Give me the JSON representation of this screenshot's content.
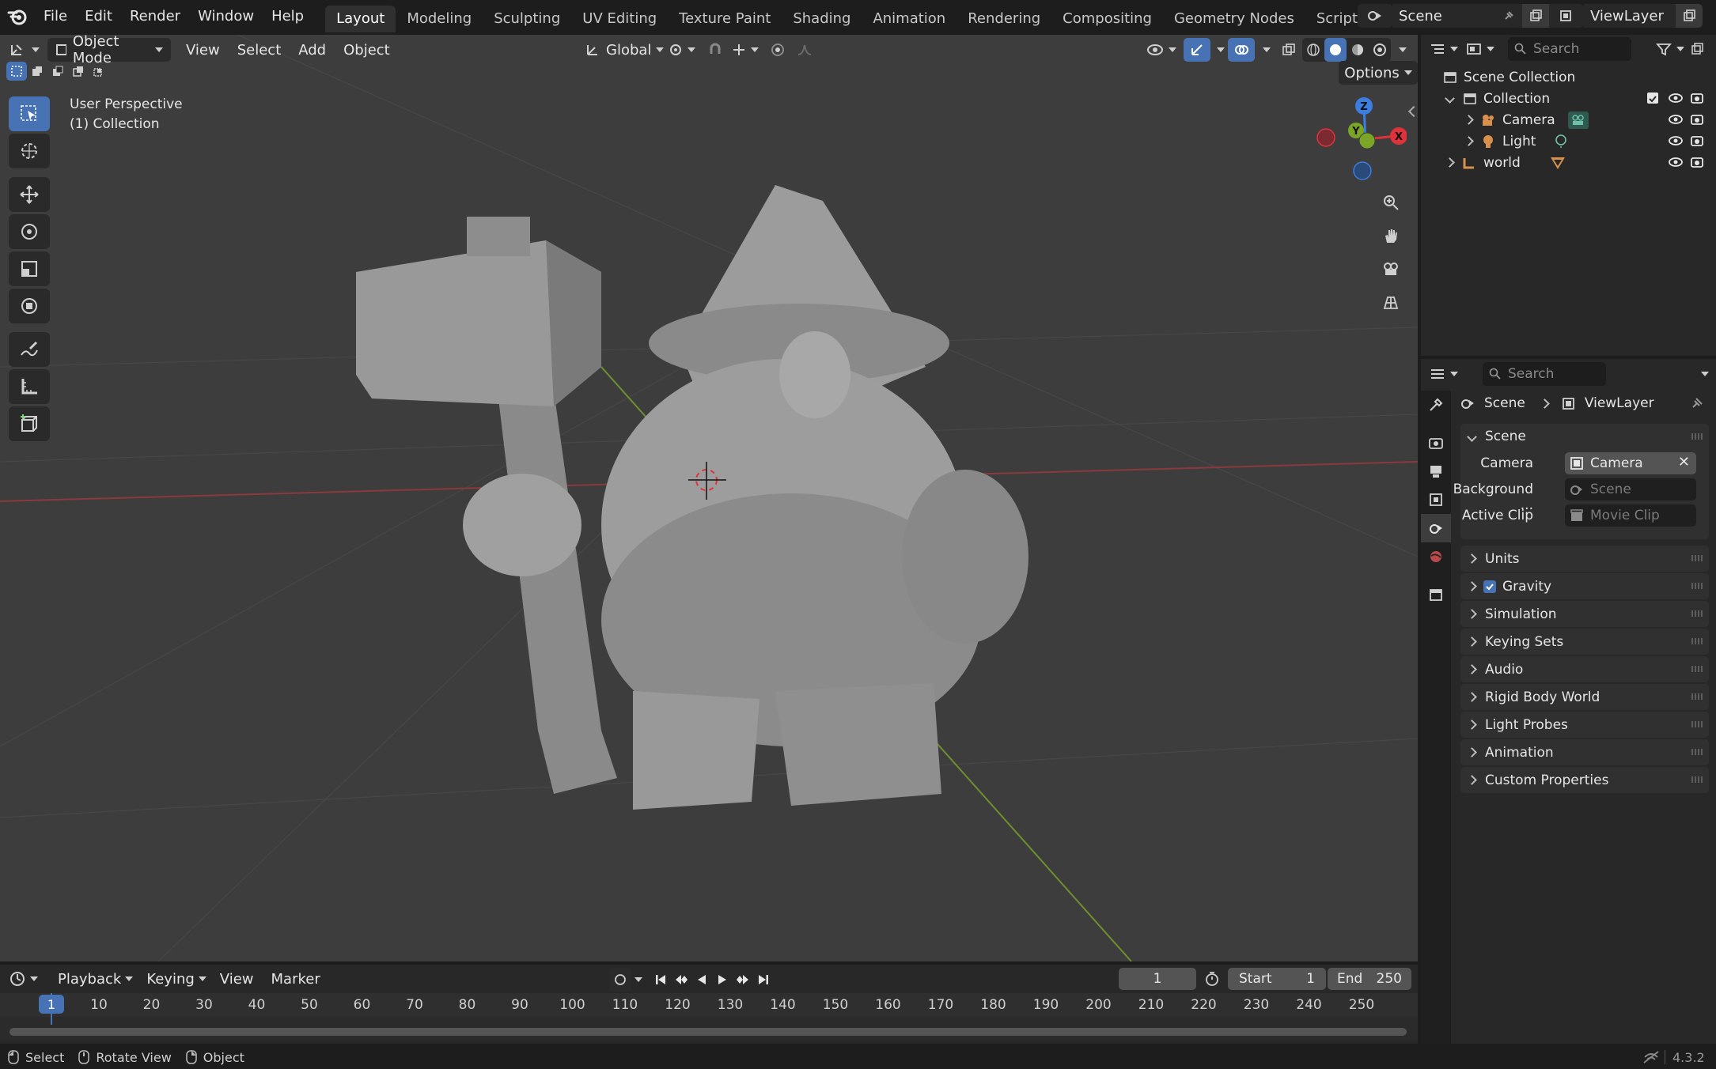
{
  "menu": [
    "File",
    "Edit",
    "Render",
    "Window",
    "Help"
  ],
  "workspaces": [
    "Layout",
    "Modeling",
    "Sculpting",
    "UV Editing",
    "Texture Paint",
    "Shading",
    "Animation",
    "Rendering",
    "Compositing",
    "Geometry Nodes",
    "Scripting"
  ],
  "scene_name": "Scene",
  "view_layer": "ViewLayer",
  "viewport": {
    "mode": "Object Mode",
    "menus": [
      "View",
      "Select",
      "Add",
      "Object"
    ],
    "orientation": "Global",
    "options_label": "Options",
    "overlay_line1": "User Perspective",
    "overlay_line2": "(1) Collection",
    "gizmo": {
      "z": "Z",
      "y": "Y",
      "x": "X"
    }
  },
  "outliner": {
    "search_placeholder": "Search",
    "scene_collection": "Scene Collection",
    "collection": "Collection",
    "items": [
      "Camera",
      "Light"
    ],
    "world": "world"
  },
  "properties": {
    "search_placeholder": "Search",
    "breadcrumb_scene": "Scene",
    "breadcrumb_layer": "ViewLayer",
    "panel_title": "Scene",
    "camera_label": "Camera",
    "camera_value": "Camera",
    "background_label": "Background ...",
    "background_value": "Scene",
    "clip_label": "Active Clip",
    "clip_value": "Movie Clip",
    "panels": [
      "Units",
      "Gravity",
      "Simulation",
      "Keying Sets",
      "Audio",
      "Rigid Body World",
      "Light Probes",
      "Animation",
      "Custom Properties"
    ]
  },
  "timeline": {
    "menus": [
      "Playback",
      "Keying",
      "View",
      "Marker"
    ],
    "current_frame": "1",
    "start_label": "Start",
    "start_value": "1",
    "end_label": "End",
    "end_value": "250",
    "ruler": [
      "1",
      "10",
      "20",
      "30",
      "40",
      "50",
      "60",
      "70",
      "80",
      "90",
      "100",
      "110",
      "120",
      "130",
      "140",
      "150",
      "160",
      "170",
      "180",
      "190",
      "200",
      "210",
      "220",
      "230",
      "240",
      "250"
    ]
  },
  "status": {
    "select": "Select",
    "rotate": "Rotate View",
    "object": "Object",
    "version": "4.3.2"
  },
  "colors": {
    "accent": "#4772b3",
    "x_axis": "#e0323b",
    "y_axis": "#7aa526",
    "z_axis": "#3b7de0"
  }
}
